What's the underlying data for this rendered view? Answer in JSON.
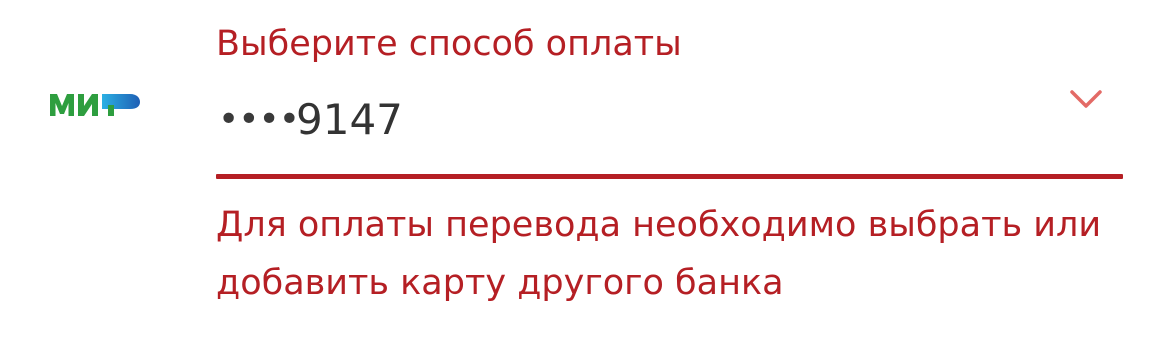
{
  "payment_method": {
    "label": "Выберите способ оплаты",
    "card_brand_icon": "mir-logo-icon",
    "card_brand_text": "МИР",
    "selected_card": {
      "mask": "••••",
      "last4": "9147"
    },
    "dropdown_icon": "chevron-down-icon",
    "error": {
      "line1": "Для оплаты перевода необходимо выбрать или",
      "line2": "добавить карту другого банка"
    }
  },
  "colors": {
    "error_red": "#b51f24",
    "mir_green": "#2e9e3f",
    "chevron_red": "#e36a66"
  }
}
